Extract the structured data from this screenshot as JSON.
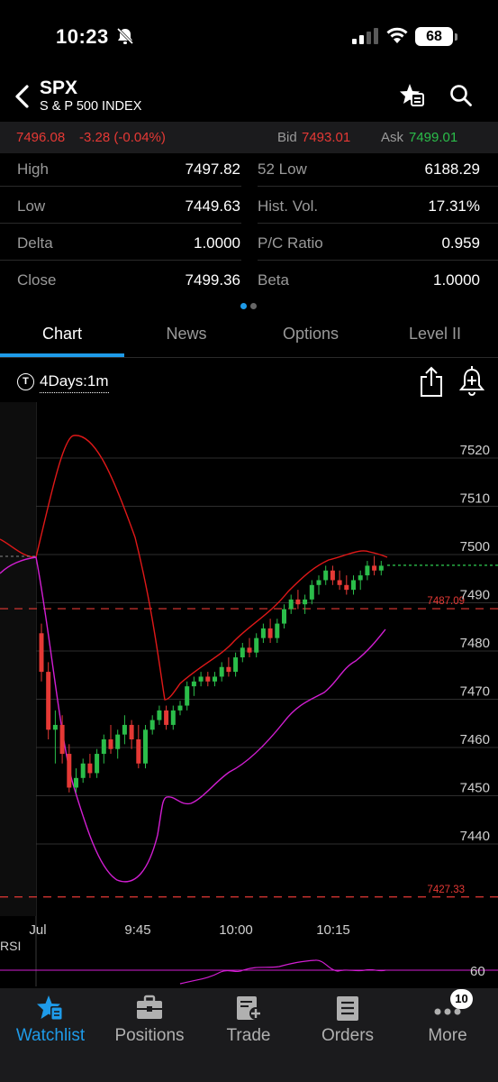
{
  "status_bar": {
    "time": "10:23",
    "battery": "68"
  },
  "header": {
    "symbol": "SPX",
    "name": "S & P 500 INDEX"
  },
  "quote": {
    "last": "7496.08",
    "change": "-3.28 (-0.04%)",
    "bid_label": "Bid",
    "bid": "7493.01",
    "ask_label": "Ask",
    "ask": "7499.01"
  },
  "stats": [
    {
      "label": "High",
      "value": "7497.82",
      "label2": "52 Low",
      "value2": "6188.29"
    },
    {
      "label": "Low",
      "value": "7449.63",
      "label2": "Hist. Vol.",
      "value2": "17.31%"
    },
    {
      "label": "Delta",
      "value": "1.0000",
      "label2": "P/C Ratio",
      "value2": "0.959"
    },
    {
      "label": "Close",
      "value": "7499.36",
      "label2": "Beta",
      "value2": "1.0000"
    }
  ],
  "tabs": [
    "Chart",
    "News",
    "Options",
    "Level II"
  ],
  "active_tab": "Chart",
  "chart_toolbar": {
    "timeframe_icon": "T",
    "timeframe": "4Days:1m"
  },
  "colors": {
    "up": "#2bbd4a",
    "down": "#e53935",
    "upper_band": "#e01818",
    "lower_band": "#d21ed2",
    "accent": "#1e9be9"
  },
  "chart_data": {
    "type": "candlestick",
    "y_range": [
      7425,
      7530
    ],
    "y_ticks": [
      7520,
      7510,
      7500,
      7490,
      7480,
      7470,
      7460,
      7450,
      7440
    ],
    "x_labels": [
      "Jul",
      "9:45",
      "10:00",
      "10:15"
    ],
    "reference_lines": [
      {
        "label": "7487.09",
        "value": 7487.09
      },
      {
        "label": "7427.33",
        "value": 7427.33
      }
    ],
    "current_price": 7496.08,
    "indicator_label": "RSI",
    "rsi_level": "60",
    "candles": [
      [
        7482,
        7484,
        7472,
        7474
      ],
      [
        7474,
        7476,
        7460,
        7462
      ],
      [
        7462,
        7466,
        7455,
        7463
      ],
      [
        7463,
        7465,
        7455,
        7457
      ],
      [
        7457,
        7459,
        7449,
        7450
      ],
      [
        7450,
        7454,
        7449,
        7452
      ],
      [
        7452,
        7456,
        7451,
        7455
      ],
      [
        7455,
        7457,
        7452,
        7453
      ],
      [
        7453,
        7458,
        7452,
        7457
      ],
      [
        7457,
        7461,
        7455,
        7460
      ],
      [
        7460,
        7463,
        7457,
        7458
      ],
      [
        7458,
        7462,
        7456,
        7461
      ],
      [
        7461,
        7465,
        7459,
        7463
      ],
      [
        7463,
        7464,
        7458,
        7460
      ],
      [
        7460,
        7463,
        7454,
        7455
      ],
      [
        7455,
        7463,
        7454,
        7462
      ],
      [
        7462,
        7465,
        7461,
        7464
      ],
      [
        7464,
        7467,
        7463,
        7466
      ],
      [
        7466,
        7467,
        7462,
        7463
      ],
      [
        7463,
        7467,
        7462,
        7466
      ],
      [
        7466,
        7468,
        7465,
        7467
      ],
      [
        7467,
        7472,
        7466,
        7471
      ],
      [
        7471,
        7473,
        7469,
        7472
      ],
      [
        7472,
        7474,
        7471,
        7473
      ],
      [
        7473,
        7474,
        7471,
        7472
      ],
      [
        7472,
        7474,
        7471,
        7473
      ],
      [
        7473,
        7476,
        7472,
        7475
      ],
      [
        7475,
        7477,
        7473,
        7474
      ],
      [
        7474,
        7478,
        7473,
        7477
      ],
      [
        7477,
        7480,
        7476,
        7479
      ],
      [
        7479,
        7481,
        7477,
        7478
      ],
      [
        7478,
        7482,
        7477,
        7481
      ],
      [
        7481,
        7484,
        7480,
        7483
      ],
      [
        7483,
        7485,
        7480,
        7481
      ],
      [
        7481,
        7485,
        7480,
        7484
      ],
      [
        7484,
        7488,
        7483,
        7487
      ],
      [
        7487,
        7490,
        7486,
        7489
      ],
      [
        7489,
        7491,
        7487,
        7488
      ],
      [
        7488,
        7490,
        7486,
        7489
      ],
      [
        7489,
        7493,
        7488,
        7492
      ],
      [
        7492,
        7494,
        7490,
        7493
      ],
      [
        7493,
        7496,
        7492,
        7495
      ],
      [
        7495,
        7496,
        7492,
        7493
      ],
      [
        7493,
        7495,
        7491,
        7492
      ],
      [
        7492,
        7494,
        7490,
        7491
      ],
      [
        7491,
        7494,
        7490,
        7493
      ],
      [
        7493,
        7495,
        7491,
        7494
      ],
      [
        7494,
        7497,
        7493,
        7496
      ],
      [
        7496,
        7498,
        7494,
        7495
      ],
      [
        7495,
        7497,
        7494,
        7496
      ]
    ]
  },
  "bottom_nav": [
    {
      "label": "Watchlist",
      "icon": "watchlist-star-icon"
    },
    {
      "label": "Positions",
      "icon": "briefcase-icon"
    },
    {
      "label": "Trade",
      "icon": "trade-ticket-icon"
    },
    {
      "label": "Orders",
      "icon": "orders-list-icon"
    },
    {
      "label": "More",
      "icon": "more-dots-icon"
    }
  ],
  "active_nav": "Watchlist",
  "more_badge": "10"
}
